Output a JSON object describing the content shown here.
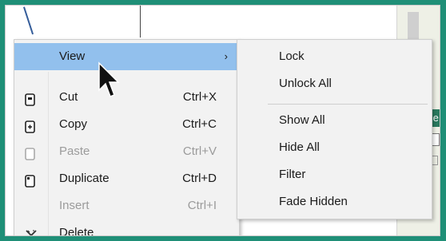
{
  "context_menu": {
    "items": [
      {
        "label": "View",
        "shortcut": "",
        "arrow": "›",
        "state": "highlighted"
      },
      {
        "label": "Cut",
        "shortcut": "Ctrl+X",
        "state": "enabled",
        "icon": "cut-icon"
      },
      {
        "label": "Copy",
        "shortcut": "Ctrl+C",
        "state": "enabled",
        "icon": "copy-icon"
      },
      {
        "label": "Paste",
        "shortcut": "Ctrl+V",
        "state": "disabled",
        "icon": "paste-icon"
      },
      {
        "label": "Duplicate",
        "shortcut": "Ctrl+D",
        "state": "enabled",
        "icon": "duplicate-icon"
      },
      {
        "label": "Insert",
        "shortcut": "Ctrl+I",
        "state": "disabled",
        "icon": ""
      },
      {
        "label": "Delete",
        "shortcut": "",
        "state": "enabled",
        "icon": "delete-icon"
      }
    ]
  },
  "submenu": {
    "items": [
      {
        "label": "Lock"
      },
      {
        "label": "Unlock All"
      },
      {
        "label": "Show All"
      },
      {
        "label": "Hide All"
      },
      {
        "label": "Filter"
      },
      {
        "label": "Fade Hidden"
      }
    ]
  },
  "background_panel": {
    "header_text": "Se"
  },
  "colors": {
    "frame_border": "#1f8f77",
    "menu_bg": "#f2f2f2",
    "highlight": "#92c0ed",
    "disabled_text": "#9b9b9b"
  }
}
